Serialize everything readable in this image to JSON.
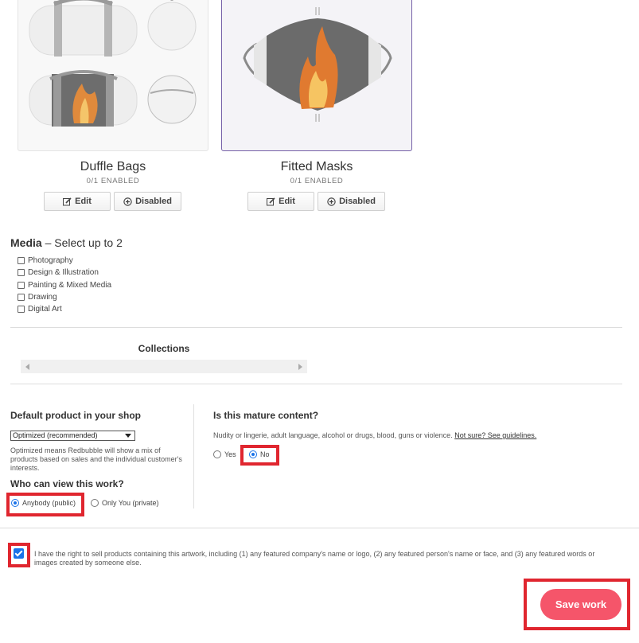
{
  "products": [
    {
      "title": "Duffle Bags",
      "enabled": "0/1 ENABLED",
      "edit_label": "Edit",
      "toggle_label": "Disabled"
    },
    {
      "title": "Fitted Masks",
      "enabled": "0/1 ENABLED",
      "edit_label": "Edit",
      "toggle_label": "Disabled"
    }
  ],
  "media": {
    "title_bold": "Media",
    "title_rest": " – Select up to 2",
    "options": [
      "Photography",
      "Design & Illustration",
      "Painting & Mixed Media",
      "Drawing",
      "Digital Art"
    ]
  },
  "collections": {
    "title": "Collections"
  },
  "default_product": {
    "heading": "Default product in your shop",
    "selected": "Optimized (recommended)",
    "help": "Optimized means Redbubble will show a mix of products based on sales and the individual customer's interests."
  },
  "visibility": {
    "heading": "Who can view this work?",
    "options": [
      "Anybody (public)",
      "Only You (private)"
    ],
    "selected": "Anybody (public)"
  },
  "mature": {
    "heading": "Is this mature content?",
    "description": "Nudity or lingerie, adult language, alcohol or drugs, blood, guns or violence.",
    "link": "Not sure? See guidelines.",
    "options": [
      "Yes",
      "No"
    ],
    "selected": "No"
  },
  "terms": {
    "text": "I have the right to sell products containing this artwork, including (1) any featured company's name or logo, (2) any featured person's name or face, and (3) any featured words or images created by someone else.",
    "checked": true
  },
  "save_label": "Save work",
  "colors": {
    "accent": "#f5556a",
    "highlight": "#e0262f",
    "selected_border": "#7560a8",
    "radio": "#1a73e8"
  }
}
